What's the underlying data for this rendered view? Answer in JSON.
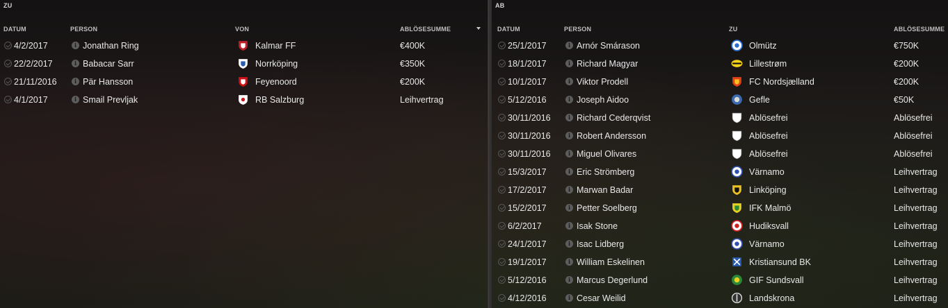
{
  "incoming": {
    "title": "ZU",
    "headers": {
      "date": "DATUM",
      "person": "PERSON",
      "club": "VON",
      "fee": "ABLÖSESUMME"
    },
    "rows": [
      {
        "date": "4/2/2017",
        "person": "Jonathan Ring",
        "club": "Kalmar FF",
        "fee": "€400K",
        "crest": "kalmar-crest",
        "color": "#c0202a",
        "color2": "#ffffff"
      },
      {
        "date": "22/2/2017",
        "person": "Babacar Sarr",
        "club": "Norrköping",
        "fee": "€350K",
        "crest": "norrkoping-crest",
        "color": "#ffffff",
        "color2": "#2a5db0"
      },
      {
        "date": "21/11/2016",
        "person": "Pär Hansson",
        "club": "Feyenoord",
        "fee": "€200K",
        "crest": "feyenoord-crest",
        "color": "#d0101a",
        "color2": "#ffffff"
      },
      {
        "date": "4/1/2017",
        "person": "Smail Prevljak",
        "club": "RB Salzburg",
        "fee": "Leihvertrag",
        "crest": "rb-salzburg-crest",
        "color": "#ffffff",
        "color2": "#d0101a"
      }
    ]
  },
  "outgoing": {
    "title": "AB",
    "headers": {
      "date": "DATUM",
      "person": "PERSON",
      "club": "ZU",
      "fee": "ABLÖSESUMME"
    },
    "rows": [
      {
        "date": "25/1/2017",
        "person": "Arnór Smárason",
        "club": "Olmütz",
        "fee": "€750K",
        "crest": "olmutz-crest",
        "color": "#2a6fd0",
        "color2": "#ffffff"
      },
      {
        "date": "18/1/2017",
        "person": "Richard Magyar",
        "club": "Lillestrøm",
        "fee": "€200K",
        "crest": "lillestrom-crest",
        "color": "#f2d21a",
        "color2": "#111111"
      },
      {
        "date": "10/1/2017",
        "person": "Viktor Prodell",
        "club": "FC Nordsjælland",
        "fee": "€200K",
        "crest": "nordsjaelland-crest",
        "color": "#e0401a",
        "color2": "#f2c21a"
      },
      {
        "date": "5/12/2016",
        "person": "Joseph Aidoo",
        "club": "Gefle",
        "fee": "€50K",
        "crest": "gefle-crest",
        "color": "#3a6ab0",
        "color2": "#d8d8d8"
      },
      {
        "date": "30/11/2016",
        "person": "Richard Cederqvist",
        "club": "Ablösefrei",
        "fee": "Ablösefrei",
        "crest": "free-agent-shield",
        "color": "#ffffff",
        "color2": "#ffffff"
      },
      {
        "date": "30/11/2016",
        "person": "Robert Andersson",
        "club": "Ablösefrei",
        "fee": "Ablösefrei",
        "crest": "free-agent-shield",
        "color": "#ffffff",
        "color2": "#ffffff"
      },
      {
        "date": "30/11/2016",
        "person": "Miguel Olivares",
        "club": "Ablösefrei",
        "fee": "Ablösefrei",
        "crest": "free-agent-shield",
        "color": "#ffffff",
        "color2": "#ffffff"
      },
      {
        "date": "15/3/2017",
        "person": "Eric Strömberg",
        "club": "Värnamo",
        "fee": "Leihvertrag",
        "crest": "varnamo-crest",
        "color": "#3050b0",
        "color2": "#ffffff"
      },
      {
        "date": "17/2/2017",
        "person": "Marwan Badar",
        "club": "Linköping",
        "fee": "Leihvertrag",
        "crest": "linkoping-crest",
        "color": "#e8c020",
        "color2": "#111111"
      },
      {
        "date": "15/2/2017",
        "person": "Petter Soelberg",
        "club": "IFK Malmö",
        "fee": "Leihvertrag",
        "crest": "ifk-malmo-crest",
        "color": "#e8d020",
        "color2": "#2a8a3a"
      },
      {
        "date": "6/2/2017",
        "person": "Isak Stone",
        "club": "Hudiksvall",
        "fee": "Leihvertrag",
        "crest": "hudiksvall-crest",
        "color": "#d02020",
        "color2": "#ffffff"
      },
      {
        "date": "24/1/2017",
        "person": "Isac Lidberg",
        "club": "Värnamo",
        "fee": "Leihvertrag",
        "crest": "varnamo-crest",
        "color": "#3050b0",
        "color2": "#ffffff"
      },
      {
        "date": "19/1/2017",
        "person": "William Eskelinen",
        "club": "Kristiansund BK",
        "fee": "Leihvertrag",
        "crest": "kristiansund-crest",
        "color": "#2a5ab0",
        "color2": "#ffffff"
      },
      {
        "date": "5/12/2016",
        "person": "Marcus Degerlund",
        "club": "GIF Sundsvall",
        "fee": "Leihvertrag",
        "crest": "gif-sundsvall-crest",
        "color": "#2a8a3a",
        "color2": "#e8d020"
      },
      {
        "date": "4/12/2016",
        "person": "Cesar Weilid",
        "club": "Landskrona",
        "fee": "Leihvertrag",
        "crest": "landskrona-crest",
        "color": "#e8e8e8",
        "color2": "#333333"
      }
    ]
  }
}
